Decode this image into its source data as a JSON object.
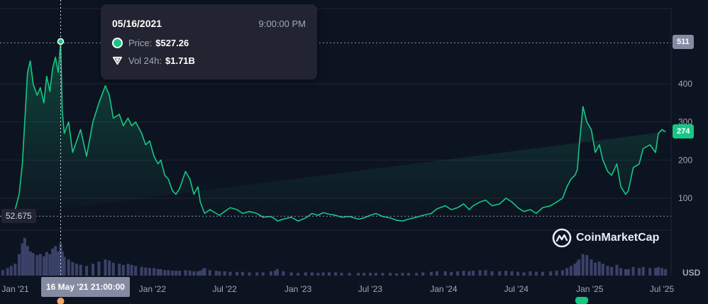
{
  "tooltip": {
    "date": "05/16/2021",
    "time": "9:00:00 PM",
    "price_label": "Price:",
    "price_value": "$527.26",
    "vol_label": "Vol 24h:",
    "vol_value": "$1.71B"
  },
  "badges": {
    "max": "511",
    "current": "274",
    "min": "52.675",
    "crosshair_x": "16 May '21 21:00:00"
  },
  "currency": "USD",
  "brand": "CoinMarketCap",
  "colors": {
    "line": "#16c784",
    "volume": "#3b4269",
    "background": "#0d1421",
    "grid": "#1e2533"
  },
  "chart_data": {
    "type": "area",
    "yticks": [
      100,
      200,
      300,
      400
    ],
    "ylim": [
      0,
      527
    ],
    "xticks": [
      "Jan '21",
      "Jan '22",
      "Jul '22",
      "Jan '23",
      "Jul '23",
      "Jan '24",
      "Jul '24",
      "Jan '25",
      "Jul '25"
    ],
    "xtick_dates": [
      "2021-01-01",
      "2022-01-01",
      "2022-07-01",
      "2023-01-01",
      "2023-07-01",
      "2024-01-01",
      "2024-07-01",
      "2025-01-01",
      "2025-07-01"
    ],
    "xlim": [
      "2020-12-15",
      "2025-07-24"
    ],
    "series": [
      {
        "dates": [
          "2020-12-22",
          "2021-01-03",
          "2021-01-12",
          "2021-01-22",
          "2021-02-01",
          "2021-02-09",
          "2021-02-15",
          "2021-02-22",
          "2021-03-01",
          "2021-03-08",
          "2021-03-18",
          "2021-03-26",
          "2021-04-04",
          "2021-04-11",
          "2021-04-19",
          "2021-04-26",
          "2021-05-03",
          "2021-05-10",
          "2021-05-16",
          "2021-05-20",
          "2021-05-25",
          "2021-06-05",
          "2021-06-15",
          "2021-06-25",
          "2021-07-05",
          "2021-07-20",
          "2021-08-05",
          "2021-08-20",
          "2021-09-05",
          "2021-09-15",
          "2021-09-25",
          "2021-10-10",
          "2021-10-20",
          "2021-11-01",
          "2021-11-10",
          "2021-11-20",
          "2021-12-05",
          "2021-12-15",
          "2021-12-25",
          "2022-01-05",
          "2022-01-15",
          "2022-01-22",
          "2022-02-01",
          "2022-02-10",
          "2022-02-20",
          "2022-03-01",
          "2022-03-10",
          "2022-03-25",
          "2022-04-05",
          "2022-04-15",
          "2022-04-25",
          "2022-05-01",
          "2022-05-08",
          "2022-05-12",
          "2022-05-25",
          "2022-06-10",
          "2022-06-18",
          "2022-07-01",
          "2022-07-15",
          "2022-08-01",
          "2022-08-15",
          "2022-09-01",
          "2022-09-20",
          "2022-10-05",
          "2022-10-25",
          "2022-11-05",
          "2022-11-10",
          "2022-11-25",
          "2022-12-15",
          "2023-01-01",
          "2023-01-20",
          "2023-02-05",
          "2023-02-20",
          "2023-03-05",
          "2023-03-20",
          "2023-04-05",
          "2023-04-20",
          "2023-05-10",
          "2023-06-01",
          "2023-06-15",
          "2023-07-01",
          "2023-07-15",
          "2023-08-01",
          "2023-08-20",
          "2023-09-05",
          "2023-09-20",
          "2023-10-05",
          "2023-10-25",
          "2023-11-10",
          "2023-12-01",
          "2023-12-15",
          "2024-01-05",
          "2024-01-20",
          "2024-02-05",
          "2024-02-20",
          "2024-03-05",
          "2024-03-15",
          "2024-04-01",
          "2024-04-15",
          "2024-05-01",
          "2024-05-20",
          "2024-06-05",
          "2024-06-20",
          "2024-07-05",
          "2024-07-20",
          "2024-08-05",
          "2024-08-20",
          "2024-09-05",
          "2024-09-25",
          "2024-10-10",
          "2024-10-25",
          "2024-11-05",
          "2024-11-15",
          "2024-11-25",
          "2024-12-01",
          "2024-12-05",
          "2024-12-15",
          "2024-12-25",
          "2025-01-05",
          "2025-01-15",
          "2025-01-25",
          "2025-02-03",
          "2025-02-15",
          "2025-02-25",
          "2025-03-10",
          "2025-03-20",
          "2025-04-01",
          "2025-04-08",
          "2025-04-20",
          "2025-05-05",
          "2025-05-15",
          "2025-06-01",
          "2025-06-15",
          "2025-06-22",
          "2025-07-01",
          "2025-07-10",
          "2025-07-20"
        ],
        "values": [
          53,
          57,
          62,
          70,
          110,
          190,
          300,
          430,
          460,
          400,
          370,
          390,
          350,
          420,
          380,
          440,
          470,
          430,
          511,
          330,
          270,
          300,
          220,
          250,
          280,
          210,
          300,
          350,
          395,
          370,
          310,
          320,
          290,
          310,
          290,
          300,
          270,
          240,
          250,
          210,
          190,
          200,
          160,
          150,
          120,
          110,
          125,
          170,
          150,
          110,
          130,
          90,
          70,
          60,
          70,
          60,
          55,
          65,
          75,
          70,
          60,
          65,
          60,
          50,
          52,
          45,
          40,
          45,
          50,
          40,
          48,
          60,
          55,
          62,
          58,
          55,
          50,
          52,
          45,
          48,
          55,
          60,
          52,
          48,
          42,
          40,
          45,
          50,
          55,
          60,
          72,
          80,
          70,
          75,
          85,
          70,
          80,
          90,
          95,
          80,
          85,
          100,
          90,
          75,
          65,
          70,
          60,
          75,
          80,
          90,
          100,
          130,
          150,
          160,
          175,
          230,
          340,
          300,
          280,
          220,
          240,
          200,
          170,
          160,
          190,
          130,
          110,
          120,
          180,
          190,
          230,
          240,
          220,
          270,
          280,
          274
        ]
      }
    ],
    "volume": {
      "description_note": "",
      "values": [
        10,
        14,
        18,
        22,
        40,
        60,
        70,
        55,
        45,
        42,
        38,
        40,
        36,
        44,
        40,
        50,
        55,
        45,
        60,
        45,
        35,
        30,
        25,
        22,
        20,
        18,
        22,
        26,
        30,
        28,
        24,
        22,
        20,
        22,
        20,
        18,
        16,
        15,
        14,
        14,
        12,
        12,
        10,
        10,
        9,
        9,
        9,
        10,
        9,
        8,
        8,
        9,
        12,
        14,
        10,
        9,
        8,
        8,
        7,
        7,
        7,
        6,
        6,
        6,
        8,
        9,
        12,
        8,
        6,
        5,
        6,
        6,
        5,
        6,
        6,
        6,
        5,
        5,
        5,
        5,
        5,
        5,
        5,
        5,
        4,
        5,
        5,
        5,
        6,
        7,
        8,
        8,
        7,
        8,
        9,
        8,
        9,
        10,
        10,
        8,
        8,
        9,
        8,
        7,
        6,
        8,
        7,
        7,
        8,
        9,
        10,
        14,
        18,
        22,
        26,
        30,
        40,
        38,
        30,
        24,
        26,
        22,
        18,
        16,
        20,
        14,
        12,
        12,
        16,
        14,
        16,
        14,
        14,
        16,
        14,
        12
      ]
    }
  }
}
